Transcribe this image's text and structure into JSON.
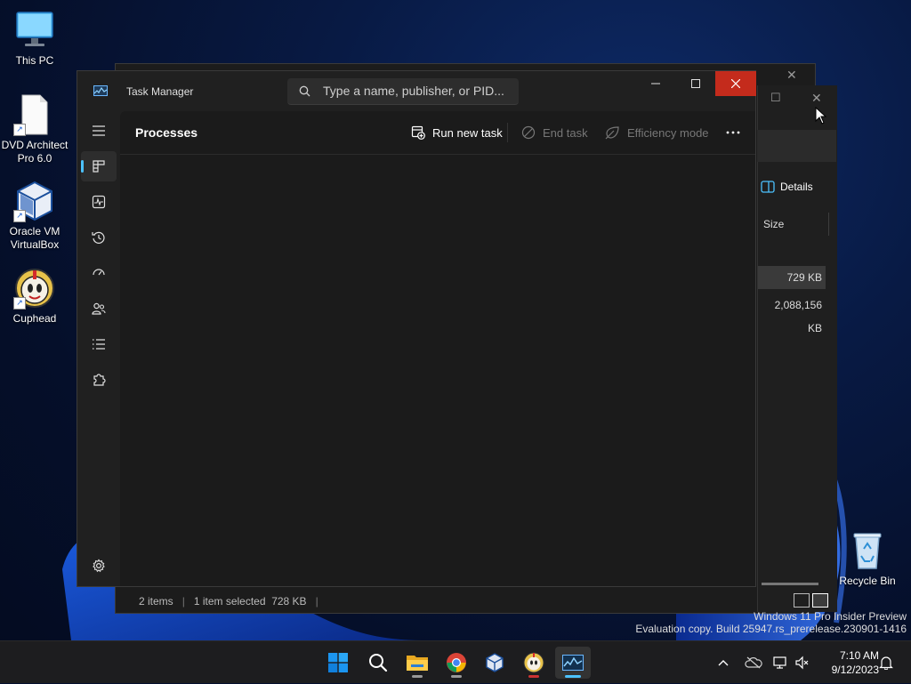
{
  "desktop": {
    "icons": [
      {
        "label": "This PC",
        "icon": "monitor-icon"
      },
      {
        "label": "DVD Architect Pro 6.0",
        "icon": "document-icon"
      },
      {
        "label": "Oracle VM VirtualBox",
        "icon": "virtualbox-icon"
      },
      {
        "label": "Cuphead",
        "icon": "cuphead-icon"
      },
      {
        "label": "Recycle Bin",
        "icon": "recycle-bin-icon"
      }
    ]
  },
  "explorer": {
    "details_label": "Details",
    "column_size": "Size",
    "rows": [
      {
        "size": "729 KB",
        "selected": true
      },
      {
        "size": "2,088,156 KB",
        "selected": false
      }
    ],
    "status": {
      "items": "2 items",
      "selected": "1 item selected  728 KB"
    }
  },
  "task_manager": {
    "title": "Task Manager",
    "search_placeholder": "Type a name, publisher, or PID...",
    "page_title": "Processes",
    "commands": {
      "run_new_task": "Run new task",
      "end_task": "End task",
      "efficiency_mode": "Efficiency mode"
    },
    "nav": [
      "Processes",
      "Performance",
      "App history",
      "Startup apps",
      "Users",
      "Details",
      "Services",
      "Settings"
    ],
    "accent": "#4cc2ff",
    "close_color": "#c42b1c"
  },
  "taskbar": {
    "apps": [
      "start-icon",
      "search-icon",
      "file-explorer-icon",
      "chrome-icon",
      "virtualbox-icon",
      "cuphead-icon",
      "task-manager-icon"
    ],
    "clock": {
      "time": "7:10 AM",
      "date": "9/12/2023"
    }
  },
  "watermark": {
    "line1": "Windows 11 Pro Insider Preview",
    "line2": "Evaluation copy. Build 25947.rs_prerelease.230901-1416"
  }
}
